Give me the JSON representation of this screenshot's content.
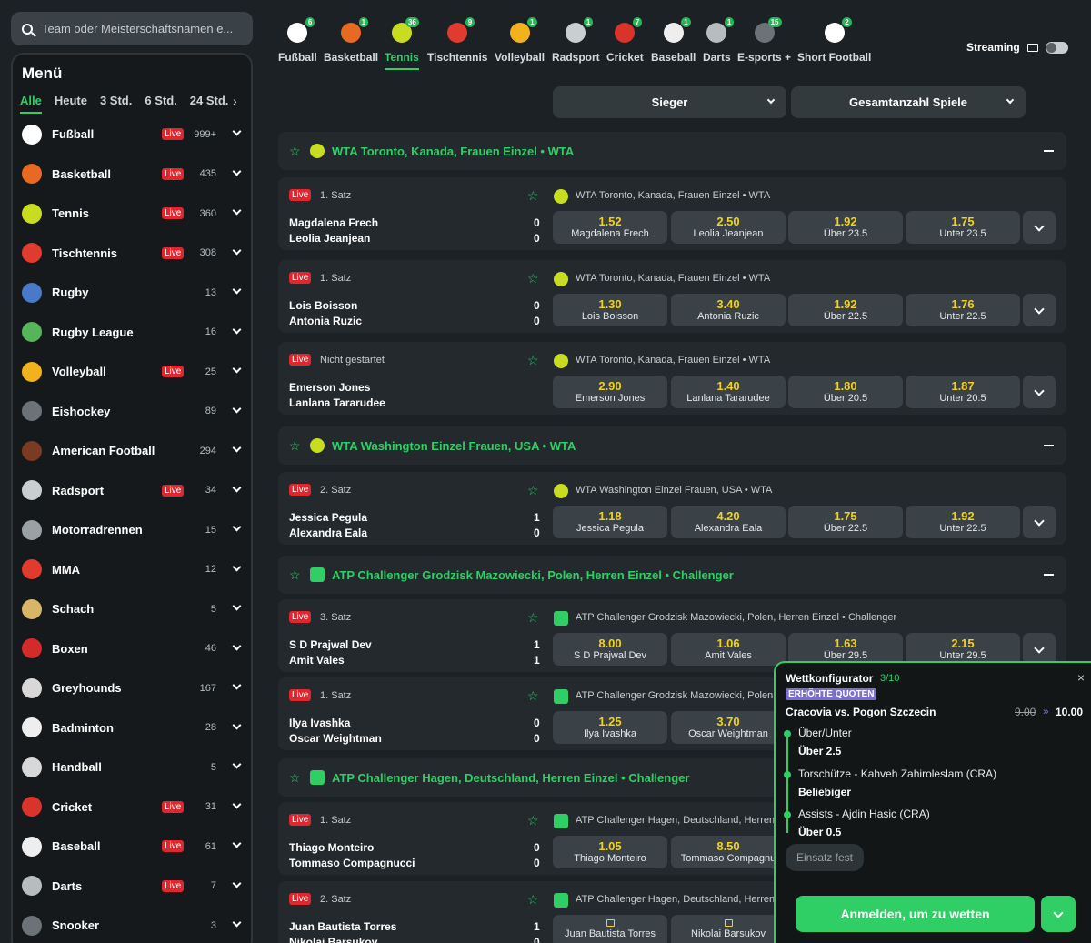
{
  "search": {
    "placeholder": "Team oder Meisterschaftsnamen e..."
  },
  "menu": {
    "title": "Menü",
    "time_filters": [
      "Alle",
      "Heute",
      "3 Std.",
      "6 Std.",
      "24 Std."
    ],
    "active_filter": "Alle",
    "live_label": "Live",
    "sports": [
      {
        "name": "Fußball",
        "live": true,
        "count": "999+",
        "color": "#ffffff"
      },
      {
        "name": "Basketball",
        "live": true,
        "count": "435",
        "color": "#e66a22"
      },
      {
        "name": "Tennis",
        "live": true,
        "count": "360",
        "color": "#c8dc20"
      },
      {
        "name": "Tischtennis",
        "live": true,
        "count": "308",
        "color": "#e13a2e"
      },
      {
        "name": "Rugby",
        "live": false,
        "count": "13",
        "color": "#4a79c8"
      },
      {
        "name": "Rugby League",
        "live": false,
        "count": "16",
        "color": "#56b45a"
      },
      {
        "name": "Volleyball",
        "live": true,
        "count": "25",
        "color": "#f2b21b"
      },
      {
        "name": "Eishockey",
        "live": false,
        "count": "89",
        "color": "#6c7378"
      },
      {
        "name": "American Football",
        "live": false,
        "count": "294",
        "color": "#7a3b22"
      },
      {
        "name": "Radsport",
        "live": true,
        "count": "34",
        "color": "#c9ced1"
      },
      {
        "name": "Motorradrennen",
        "live": false,
        "count": "15",
        "color": "#9aa1a5"
      },
      {
        "name": "MMA",
        "live": false,
        "count": "12",
        "color": "#e13a2e"
      },
      {
        "name": "Schach",
        "live": false,
        "count": "5",
        "color": "#d9b56a"
      },
      {
        "name": "Boxen",
        "live": false,
        "count": "46",
        "color": "#d42a2a"
      },
      {
        "name": "Greyhounds",
        "live": false,
        "count": "167",
        "color": "#d8d8d8"
      },
      {
        "name": "Badminton",
        "live": false,
        "count": "28",
        "color": "#eeeeee"
      },
      {
        "name": "Handball",
        "live": false,
        "count": "5",
        "color": "#d8d8d8"
      },
      {
        "name": "Cricket",
        "live": true,
        "count": "31",
        "color": "#d9342b"
      },
      {
        "name": "Baseball",
        "live": true,
        "count": "61",
        "color": "#eeeeee"
      },
      {
        "name": "Darts",
        "live": true,
        "count": "7",
        "color": "#b7bcbf"
      },
      {
        "name": "Snooker",
        "live": false,
        "count": "3",
        "color": "#6c7378"
      }
    ]
  },
  "top_sports": [
    {
      "label": "Fußball",
      "badge": "6",
      "color": "#ffffff",
      "active": false
    },
    {
      "label": "Basketball",
      "badge": "1",
      "color": "#e66a22",
      "active": false
    },
    {
      "label": "Tennis",
      "badge": "36",
      "color": "#c8dc20",
      "active": true
    },
    {
      "label": "Tischtennis",
      "badge": "9",
      "color": "#e13a2e",
      "active": false
    },
    {
      "label": "Volleyball",
      "badge": "1",
      "color": "#f2b21b",
      "active": false
    },
    {
      "label": "Radsport",
      "badge": "1",
      "color": "#c9ced1",
      "active": false
    },
    {
      "label": "Cricket",
      "badge": "7",
      "color": "#d9342b",
      "active": false
    },
    {
      "label": "Baseball",
      "badge": "1",
      "color": "#eeeeee",
      "active": false
    },
    {
      "label": "Darts",
      "badge": "1",
      "color": "#b7bcbf",
      "active": false
    },
    {
      "label": "E-sports +",
      "badge": "15",
      "color": "#6c7378",
      "active": false
    },
    {
      "label": "Short Football",
      "badge": "2",
      "color": "#ffffff",
      "active": false
    }
  ],
  "streaming": {
    "label": "Streaming"
  },
  "market_dropdowns": [
    {
      "label": "Sieger"
    },
    {
      "label": "Gesamtanzahl Spiele"
    }
  ],
  "leagues": [
    {
      "name": "WTA Toronto, Kanada, Frauen Einzel • WTA",
      "icon": "tennis-ball-icon"
    },
    {
      "name": "WTA Washington Einzel Frauen, USA • WTA",
      "icon": "tennis-ball-icon"
    },
    {
      "name": "ATP Challenger Grodzisk Mazowiecki, Polen, Herren Einzel • Challenger",
      "icon": "globe-icon"
    },
    {
      "name": "ATP Challenger Hagen, Deutschland, Herren Einzel • Challenger",
      "icon": "globe-icon"
    }
  ],
  "events": [
    {
      "status": "1. Satz",
      "live": true,
      "p1": "Magdalena Frech",
      "p2": "Leolia Jeanjean",
      "s1": "0",
      "s2": "0",
      "league": "WTA Toronto, Kanada, Frauen Einzel • WTA",
      "icon": "tennis-ball-icon",
      "odds": [
        {
          "v": "1.52",
          "l": "Magdalena Frech"
        },
        {
          "v": "2.50",
          "l": "Leolia Jeanjean"
        },
        {
          "v": "1.92",
          "l": "Über 23.5"
        },
        {
          "v": "1.75",
          "l": "Unter 23.5"
        }
      ]
    },
    {
      "status": "1. Satz",
      "live": true,
      "p1": "Lois Boisson",
      "p2": "Antonia Ruzic",
      "s1": "0",
      "s2": "0",
      "league": "WTA Toronto, Kanada, Frauen Einzel • WTA",
      "icon": "tennis-ball-icon",
      "odds": [
        {
          "v": "1.30",
          "l": "Lois Boisson"
        },
        {
          "v": "3.40",
          "l": "Antonia Ruzic"
        },
        {
          "v": "1.92",
          "l": "Über 22.5"
        },
        {
          "v": "1.76",
          "l": "Unter 22.5"
        }
      ]
    },
    {
      "status": "Nicht gestartet",
      "live": true,
      "p1": "Emerson Jones",
      "p2": "Lanlana Tararudee",
      "s1": "",
      "s2": "",
      "league": "WTA Toronto, Kanada, Frauen Einzel • WTA",
      "icon": "tennis-ball-icon",
      "odds": [
        {
          "v": "2.90",
          "l": "Emerson Jones"
        },
        {
          "v": "1.40",
          "l": "Lanlana Tararudee"
        },
        {
          "v": "1.80",
          "l": "Über 20.5"
        },
        {
          "v": "1.87",
          "l": "Unter 20.5"
        }
      ]
    },
    {
      "status": "2. Satz",
      "live": true,
      "p1": "Jessica Pegula",
      "p2": "Alexandra Eala",
      "s1": "1",
      "s2": "0",
      "league": "WTA Washington Einzel Frauen, USA • WTA",
      "icon": "tennis-ball-icon",
      "odds": [
        {
          "v": "1.18",
          "l": "Jessica Pegula"
        },
        {
          "v": "4.20",
          "l": "Alexandra Eala"
        },
        {
          "v": "1.75",
          "l": "Über 22.5"
        },
        {
          "v": "1.92",
          "l": "Unter 22.5"
        }
      ]
    },
    {
      "status": "3. Satz",
      "live": true,
      "p1": "S D Prajwal Dev",
      "p2": "Amit Vales",
      "s1": "1",
      "s2": "1",
      "league": "ATP Challenger Grodzisk Mazowiecki, Polen, Herren Einzel • Challenger",
      "icon": "globe-icon",
      "odds": [
        {
          "v": "8.00",
          "l": "S D Prajwal Dev"
        },
        {
          "v": "1.06",
          "l": "Amit Vales"
        },
        {
          "v": "1.63",
          "l": "Über 29.5"
        },
        {
          "v": "2.15",
          "l": "Unter 29.5"
        }
      ]
    },
    {
      "status": "1. Satz",
      "live": true,
      "p1": "Ilya Ivashka",
      "p2": "Oscar Weightman",
      "s1": "0",
      "s2": "0",
      "league": "ATP Challenger Grodzisk Mazowiecki, Polen, H",
      "icon": "globe-icon",
      "odds": [
        {
          "v": "1.25",
          "l": "Ilya Ivashka"
        },
        {
          "v": "3.70",
          "l": "Oscar Weightman"
        }
      ]
    },
    {
      "status": "1. Satz",
      "live": true,
      "p1": "Thiago Monteiro",
      "p2": "Tommaso Compagnucci",
      "s1": "0",
      "s2": "0",
      "league": "ATP Challenger Hagen, Deutschland, Herren Ei",
      "icon": "globe-icon",
      "odds": [
        {
          "v": "1.05",
          "l": "Thiago Monteiro"
        },
        {
          "v": "8.50",
          "l": "Tommaso Compagnu"
        }
      ]
    },
    {
      "status": "2. Satz",
      "live": true,
      "p1": "Juan Bautista Torres",
      "p2": "Nikolai Barsukov",
      "s1": "1",
      "s2": "0",
      "league": "ATP Challenger Hagen, Deutschland, Herren Ei",
      "icon": "globe-icon",
      "odds": [
        {
          "v": "",
          "l": "Juan Bautista Torres",
          "locked": true
        },
        {
          "v": "",
          "l": "Nikolai Barsukov",
          "locked": true
        }
      ]
    }
  ],
  "bet_builder": {
    "title": "Wettkonfigurator",
    "count": "3/10",
    "badge": "ERHÖHTE QUOTEN",
    "match": "Cracovia vs. Pogon Szczecin",
    "old_odds": "9.00",
    "arrow": "»",
    "new_odds": "10.00",
    "selections": [
      {
        "market": "Über/Unter",
        "value": "Über 2.5"
      },
      {
        "market": "Torschütze - Kahveh Zahiroleslam (CRA)",
        "value": "Beliebiger"
      },
      {
        "market": "Assists - Ajdin Hasic (CRA)",
        "value": "Über 0.5"
      }
    ],
    "stake_placeholder": "Einsatz fest",
    "login_label": "Anmelden, um zu wetten"
  },
  "colors": {
    "accent": "#2fcf66",
    "live": "#e0262f",
    "odds": "#f2d21b",
    "boost": "#7b6fc9"
  }
}
